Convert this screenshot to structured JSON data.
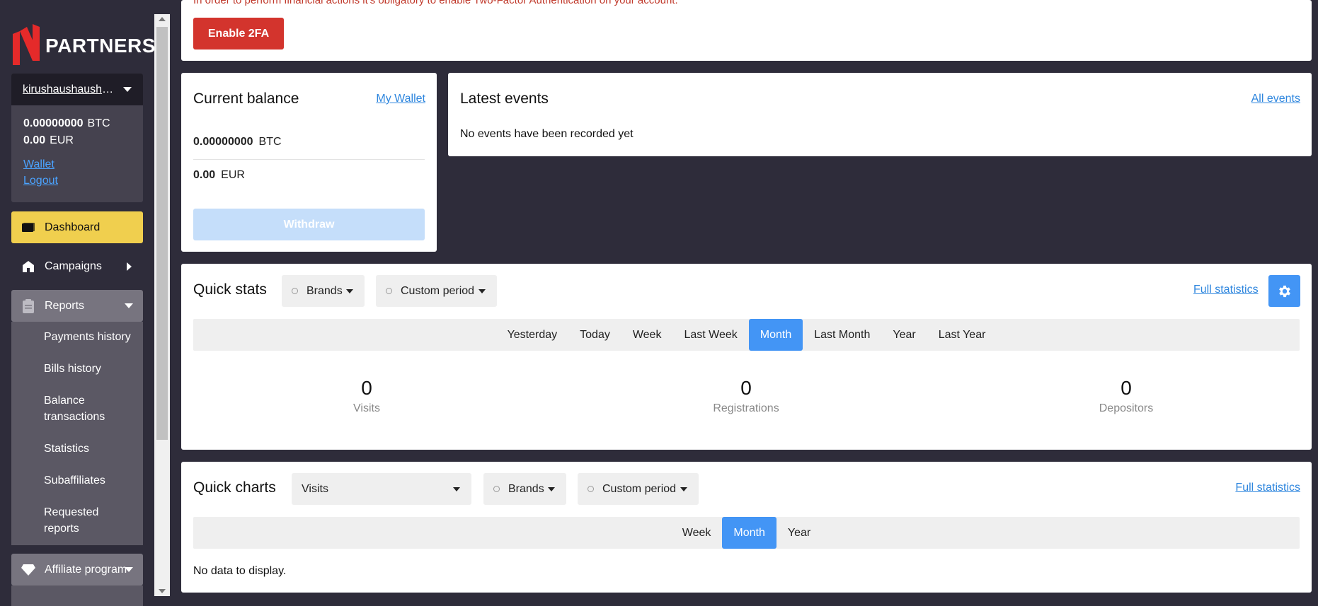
{
  "brand": {
    "logo_text": "PARTNERS",
    "accent": "#e52a2a"
  },
  "account": {
    "username": "kirushaushaushaush",
    "btc_amount": "0.00000000",
    "btc_unit": "BTC",
    "eur_amount": "0.00",
    "eur_unit": "EUR",
    "wallet_link": "Wallet",
    "logout_link": "Logout"
  },
  "nav": {
    "dashboard": "Dashboard",
    "campaigns": "Campaigns",
    "reports": "Reports",
    "reports_sub": [
      "Payments history",
      "Bills history",
      "Balance transactions",
      "Statistics",
      "Subaffiliates",
      "Requested reports"
    ],
    "affiliate": "Affiliate program"
  },
  "twofa": {
    "notice": "In order to perform financial actions it's obligatory to enable Two-Factor Authentication on your account.",
    "button": "Enable 2FA"
  },
  "balance": {
    "title": "Current balance",
    "wallet_link": "My Wallet",
    "btc_amount": "0.00000000",
    "btc_unit": "BTC",
    "eur_amount": "0.00",
    "eur_unit": "EUR",
    "withdraw": "Withdraw"
  },
  "events": {
    "title": "Latest events",
    "all_link": "All events",
    "empty": "No events have been recorded yet"
  },
  "quick_stats": {
    "title": "Quick stats",
    "brands": "Brands",
    "period": "Custom period",
    "full_link": "Full statistics",
    "periods": [
      "Yesterday",
      "Today",
      "Week",
      "Last Week",
      "Month",
      "Last Month",
      "Year",
      "Last Year"
    ],
    "active_period": "Month",
    "stats": [
      {
        "value": "0",
        "label": "Visits"
      },
      {
        "value": "0",
        "label": "Registrations"
      },
      {
        "value": "0",
        "label": "Depositors"
      }
    ]
  },
  "quick_charts": {
    "title": "Quick charts",
    "metric": "Visits",
    "brands": "Brands",
    "period": "Custom period",
    "full_link": "Full statistics",
    "periods": [
      "Week",
      "Month",
      "Year"
    ],
    "active_period": "Month",
    "empty": "No data to display."
  },
  "colors": {
    "primary": "#4395f5",
    "danger": "#d3342d",
    "dashboard_active": "#f0cf4e",
    "sidebar_bg": "#2e2c3a"
  }
}
